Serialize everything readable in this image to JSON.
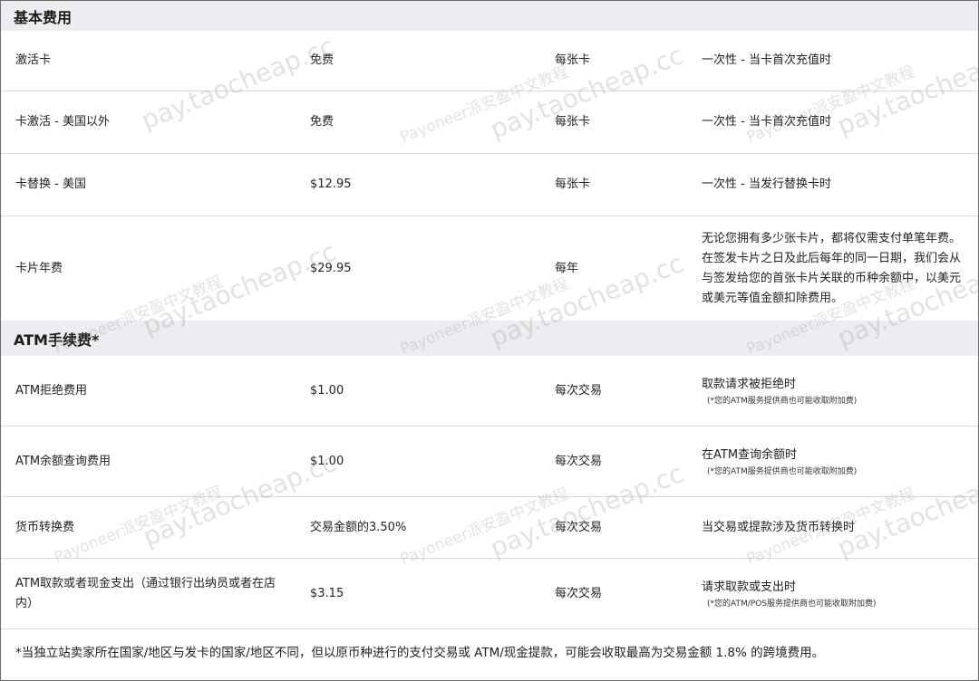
{
  "sections": {
    "basic": {
      "title": "基本费用",
      "rows": [
        {
          "item": "激活卡",
          "fee": "免费",
          "frequency": "每张卡",
          "description": "一次性 - 当卡首次充值时"
        },
        {
          "item": "卡激活 - 美国以外",
          "fee": "免费",
          "frequency": "每张卡",
          "description": "一次性 - 当卡首次充值时"
        },
        {
          "item": "卡替换 - 美国",
          "fee": "$12.95",
          "frequency": "每张卡",
          "description": "一次性 - 当发行替换卡时"
        },
        {
          "item": "卡片年费",
          "fee": "$29.95",
          "frequency": "每年",
          "description": "无论您拥有多少张卡片，都将仅需支付单笔年费。在签发卡片之日及此后每年的同一日期，我们会从与签发给您的首张卡片关联的币种余额中，以美元或美元等值金额扣除费用。"
        }
      ]
    },
    "atm": {
      "title": "ATM手续费*",
      "rows": [
        {
          "item": "ATM拒绝费用",
          "fee": "$1.00",
          "frequency": "每次交易",
          "description": "取款请求被拒绝时",
          "note": "(*您的ATM服务提供商也可能收取附加费)"
        },
        {
          "item": "ATM余额查询费用",
          "fee": "$1.00",
          "frequency": "每次交易",
          "description": "在ATM查询余额时",
          "note": "(*您的ATM服务提供商也可能收取附加费)"
        },
        {
          "item": "货币转换费",
          "fee": "交易金额的3.50%",
          "frequency": "每次交易",
          "description": "当交易或提款涉及货币转换时"
        },
        {
          "item": "ATM取款或者现金支出（通过银行出纳员或者在店内）",
          "fee": "$3.15",
          "frequency": "每次交易",
          "description": "请求取款或支出时",
          "note": "(*您的ATM/POS服务提供商也可能收取附加费)"
        }
      ]
    }
  },
  "footnote": "*当独立站卖家所在国家/地区与发卡的国家/地区不同，但以原币种进行的支付交易或 ATM/现金提款，可能会收取最高为交易金额 1.8% 的跨境费用。",
  "watermark": {
    "url": "pay.taocheap.cc",
    "text": "Payoneer派安盈中文教程"
  },
  "colors": {
    "header_bg": "#ebedf0",
    "border": "#d9d9d9",
    "frame": "#6b6b6b"
  }
}
